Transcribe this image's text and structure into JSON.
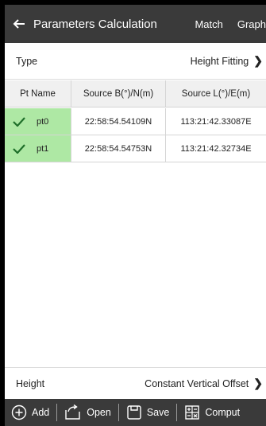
{
  "header": {
    "title": "Parameters Calculation",
    "actions": [
      "Match",
      "Graph"
    ]
  },
  "type_row": {
    "label": "Type",
    "value": "Height Fitting"
  },
  "table": {
    "columns": [
      "Pt Name",
      "Source B(°)/N(m)",
      "Source L(°)/E(m)"
    ],
    "rows": [
      {
        "name": "pt0",
        "b": "22:58:54.54109N",
        "l": "113:21:42.33087E"
      },
      {
        "name": "pt1",
        "b": "22:58:54.54753N",
        "l": "113:21:42.32734E"
      }
    ]
  },
  "height_row": {
    "label": "Height",
    "value": "Constant Vertical Offset"
  },
  "toolbar": {
    "add": "Add",
    "open": "Open",
    "save": "Save",
    "compute": "Comput"
  },
  "colors": {
    "bar": "#3a3a3a",
    "selected_row": "#aee8a4",
    "check": "#1f6f2a"
  }
}
